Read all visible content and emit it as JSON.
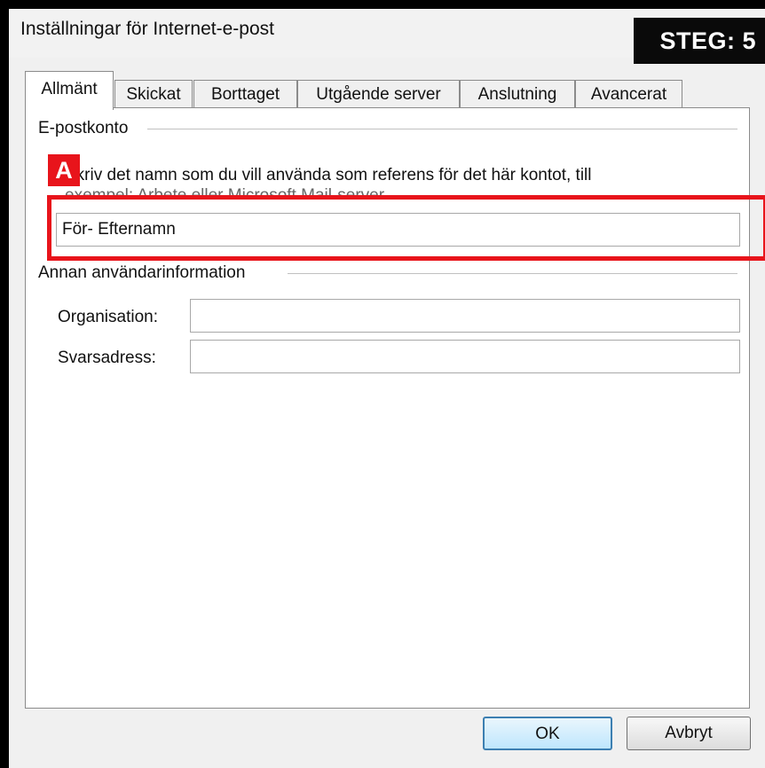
{
  "window": {
    "title": "Inställningar för Internet-e-post",
    "step_label": "STEG: 5"
  },
  "tabs": [
    {
      "label": "Allmänt",
      "active": true
    },
    {
      "label": "Skickat",
      "active": false
    },
    {
      "label": "Borttaget",
      "active": false
    },
    {
      "label": "Utgående server",
      "active": false
    },
    {
      "label": "Anslutning",
      "active": false
    },
    {
      "label": "Avancerat",
      "active": false
    }
  ],
  "account_group": {
    "title": "E-postkonto",
    "description": "Skriv det namn som du vill använda som referens för det här kontot, till",
    "description_line2": "exempel: Arbete eller Microsoft Mail-server.",
    "account_name_value": "För- Efternamn",
    "annotation_badge": "A"
  },
  "user_info_group": {
    "title": "Annan användarinformation",
    "organisation_label": "Organisation:",
    "organisation_value": "",
    "reply_label": "Svarsadress:",
    "reply_value": ""
  },
  "buttons": {
    "ok": "OK",
    "cancel": "Avbryt"
  },
  "colors": {
    "annotation": "#e8141b",
    "ok_border": "#3c7fb1"
  }
}
